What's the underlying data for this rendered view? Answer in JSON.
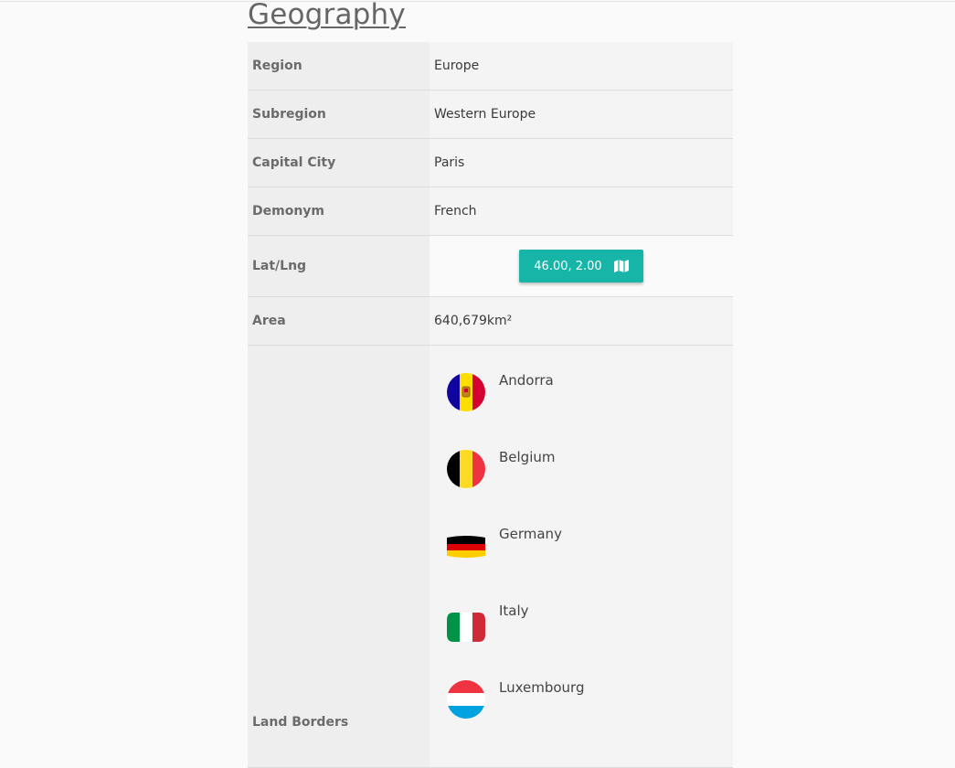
{
  "section": {
    "title": "Geography"
  },
  "rows": {
    "region": {
      "label": "Region",
      "value": "Europe"
    },
    "subregion": {
      "label": "Subregion",
      "value": "Western Europe"
    },
    "capital": {
      "label": "Capital City",
      "value": "Paris"
    },
    "demonym": {
      "label": "Demonym",
      "value": "French"
    },
    "latlng": {
      "label": "Lat/Lng",
      "button_label": "46.00, 2.00",
      "icon": "map-icon"
    },
    "area": {
      "label": "Area",
      "value": "640,679km²"
    },
    "borders": {
      "label": "Land Borders",
      "items": [
        {
          "name": "Andorra",
          "flag": "andorra-flag-icon"
        },
        {
          "name": "Belgium",
          "flag": "belgium-flag-icon"
        },
        {
          "name": "Germany",
          "flag": "germany-flag-icon"
        },
        {
          "name": "Italy",
          "flag": "italy-flag-icon"
        },
        {
          "name": "Luxembourg",
          "flag": "luxembourg-flag-icon"
        }
      ]
    }
  },
  "colors": {
    "accent": "#16b5a7",
    "key_bg": "#eeeeee",
    "value_bg": "#f4f4f4"
  }
}
